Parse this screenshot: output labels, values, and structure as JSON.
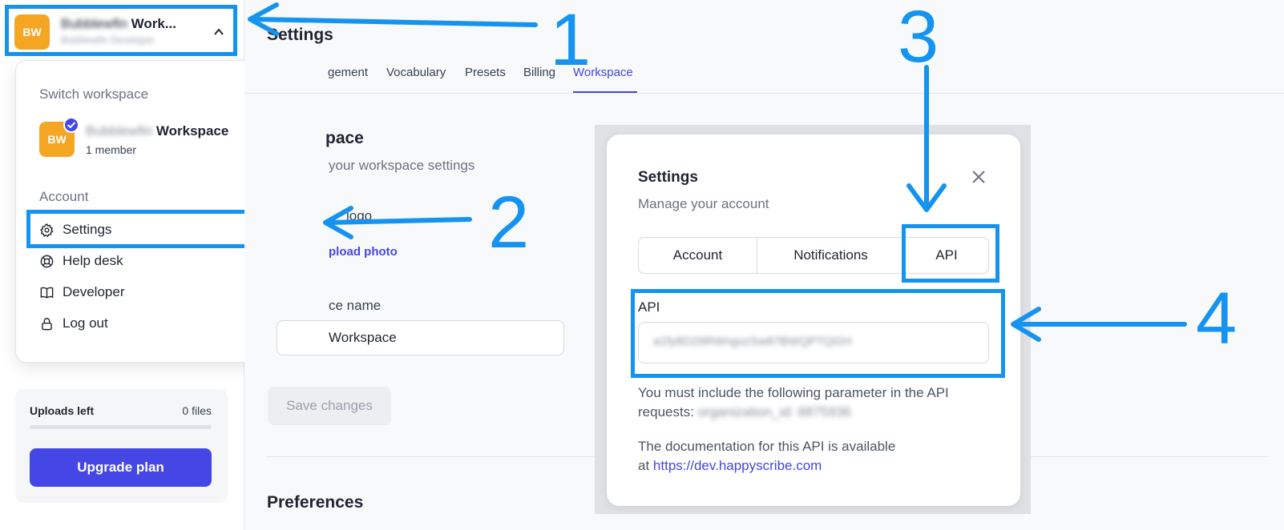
{
  "sidebar": {
    "workspace": {
      "avatar_initials": "BW",
      "name_blurred": "Bubblewfin",
      "name_suffix": "Work...",
      "sub_blurred": "Bubblewfin Developer"
    },
    "dropdown": {
      "switch_label": "Switch workspace",
      "workspace": {
        "avatar_initials": "BW",
        "name_blurred": "Bubblewfin",
        "name_suffix": "Workspace",
        "members": "1 member"
      },
      "account_label": "Account",
      "items": [
        {
          "label": "Settings",
          "icon": "gear-icon"
        },
        {
          "label": "Help desk",
          "icon": "lifebuoy-icon"
        },
        {
          "label": "Developer",
          "icon": "book-icon"
        },
        {
          "label": "Log out",
          "icon": "lock-icon"
        }
      ]
    },
    "uploads": {
      "label": "Uploads left",
      "count": "0 files",
      "progress": 0,
      "upgrade_label": "Upgrade plan"
    }
  },
  "main": {
    "title": "Settings",
    "tabs": [
      "gement",
      "Vocabulary",
      "Presets",
      "Billing",
      "Workspace"
    ],
    "active_tab": "Workspace",
    "section": {
      "title_fragment": "pace",
      "subtitle_fragment": "your workspace settings",
      "logo_label_fragment": "logo",
      "upload_label": "pload photo",
      "name_label_fragment": "ce name",
      "name_value_fragment": "Workspace",
      "save_label": "Save changes",
      "preferences_label": "Preferences"
    }
  },
  "modal": {
    "title": "Settings",
    "subtitle": "Manage your account",
    "tabs": [
      "Account",
      "Notifications",
      "API"
    ],
    "active_tab": "API",
    "api_label": "API",
    "api_key_blurred": "a1fy8D29RWngvzSw87BWQPTQGH",
    "note_line1": "You must include the following parameter in the API",
    "note_line2": "requests:",
    "param_blurred": "organization_id: 8875936",
    "doc_line1": "The documentation for this API is available",
    "doc_line2": "at",
    "doc_link": "https://dev.happyscribe.com"
  },
  "annotations": {
    "numbers": [
      "1",
      "2",
      "3",
      "4"
    ],
    "color": "#1593f0"
  },
  "colors": {
    "accent": "#4446e6",
    "avatar": "#f5a623",
    "annotation": "#1593f0"
  }
}
